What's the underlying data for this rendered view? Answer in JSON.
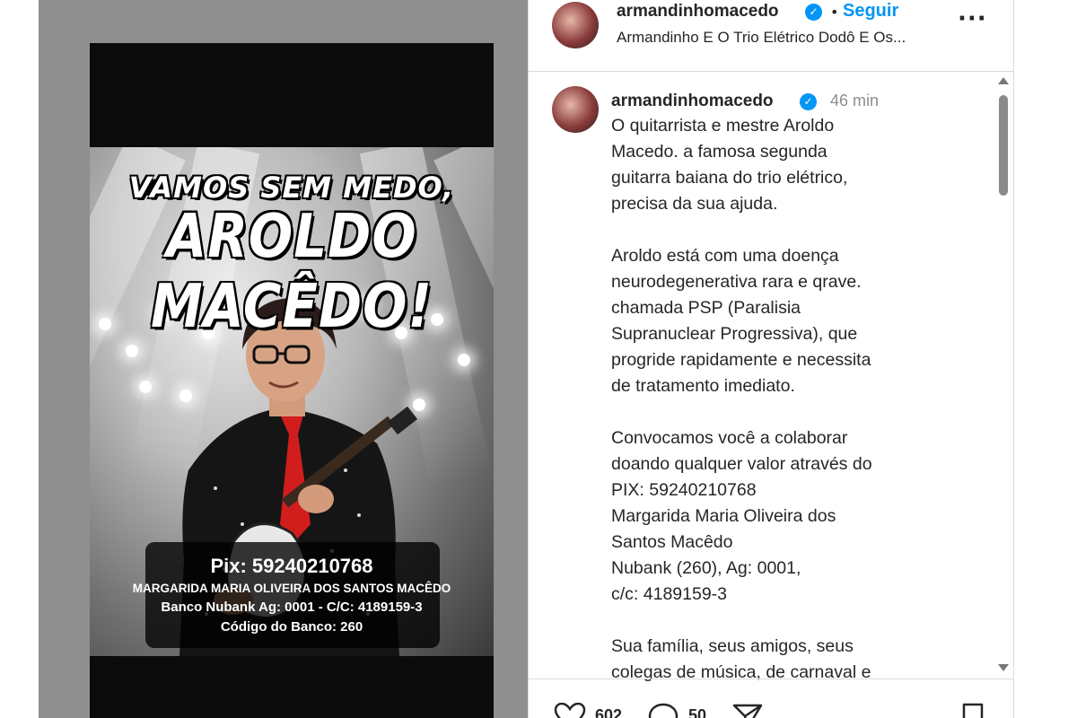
{
  "media": {
    "poster_line1": "VAMOS SEM MEDO,",
    "poster_line2": "AROLDO MACÊDO!",
    "pix": "Pix: 59240210768",
    "holder": "MARGARIDA MARIA OLIVEIRA DOS SANTOS MACÊDO",
    "bank": "Banco Nubank  Ag: 0001 - C/C: 4189159-3",
    "bank_code": "Código do Banco: 260"
  },
  "header": {
    "username": "armandinhomacedo",
    "follow_label": "Seguir",
    "separator": "•",
    "subtitle": "Armandinho E O Trio Elétrico Dodô E Os...",
    "more_icon": "more-horizontal-icon"
  },
  "post": {
    "username": "armandinhomacedo",
    "time": "46 min",
    "caption": "O  quitarrista e mestre Aroldo\nMacedo. a famosa segunda\nguitarra baiana do trio elétrico,\nprecisa da sua ajuda.\n\nAroldo está com uma doença\nneurodegenerativa rara e qrave.\nchamada PSP (Paralisia\nSupranuclear Progressiva), que\nprogride rapidamente e necessita\nde tratamento imediato.\n\nConvocamos você a colaborar\ndoando qualquer valor através do\nPIX: 59240210768\nMargarida Maria Oliveira dos\nSantos Macêdo\nNubank (260), Ag: 0001,\nc/c: 4189159-3\n\nSua família, seus amigos, seus\ncolegas de música, de carnaval e"
  },
  "actions": {
    "likes": "602",
    "comments": "50"
  },
  "colors": {
    "accent": "#0095f6",
    "text": "#262626",
    "muted": "#8e8e8e"
  }
}
